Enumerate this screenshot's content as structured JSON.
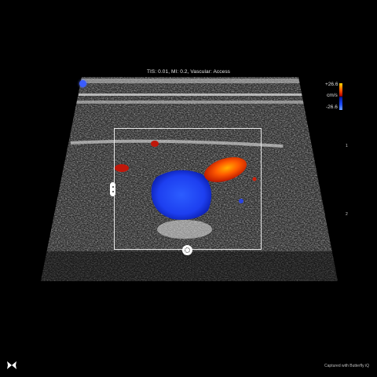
{
  "header": {
    "text": "TIS: 0.01, MI: 0.2, Vascular: Access"
  },
  "color_scale": {
    "max_label": "+26.6",
    "unit_label": "cm/s",
    "min_label": "-26.6",
    "max_color": "#ff5a00",
    "min_color": "#1e4dff"
  },
  "depth_scale": {
    "ticks": [
      "1",
      "2"
    ]
  },
  "footer": {
    "caption": "Captured with Butterfly iQ"
  },
  "icons": {
    "logo": "butterfly-logo-icon",
    "orientation": "orientation-marker-icon"
  }
}
